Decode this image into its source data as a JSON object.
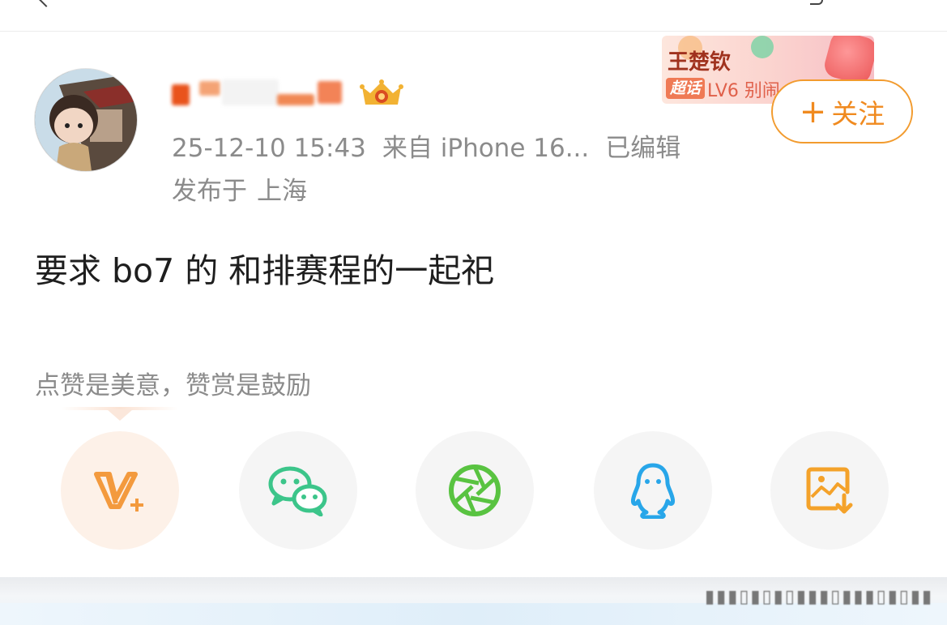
{
  "post": {
    "timestamp": "25-12-10 15:43",
    "source": "来自 iPhone 16...",
    "edited": "已编辑",
    "location_prefix": "发布于",
    "location": "上海",
    "text": "要求 bo7 的 和排赛程的一起祀"
  },
  "supertopic": {
    "name": "王楚钦",
    "badge": "超话",
    "level": "LV6 别闹"
  },
  "follow": {
    "plus": "+",
    "label": "关注"
  },
  "tip": {
    "text": "点赞是美意，赞赏是鼓励"
  },
  "share": {
    "items": [
      {
        "icon": "v-plus-icon",
        "color": "#f39a3e"
      },
      {
        "icon": "wechat-icon",
        "color": "#3cc58a"
      },
      {
        "icon": "moments-aperture-icon",
        "color": "#59c341"
      },
      {
        "icon": "qq-penguin-icon",
        "color": "#28a6e9"
      },
      {
        "icon": "save-image-icon",
        "color": "#f4a22a"
      }
    ]
  },
  "colors": {
    "accent": "#f08a1f",
    "meta_text": "#8b8b8b",
    "body_text": "#1e1e1e"
  }
}
